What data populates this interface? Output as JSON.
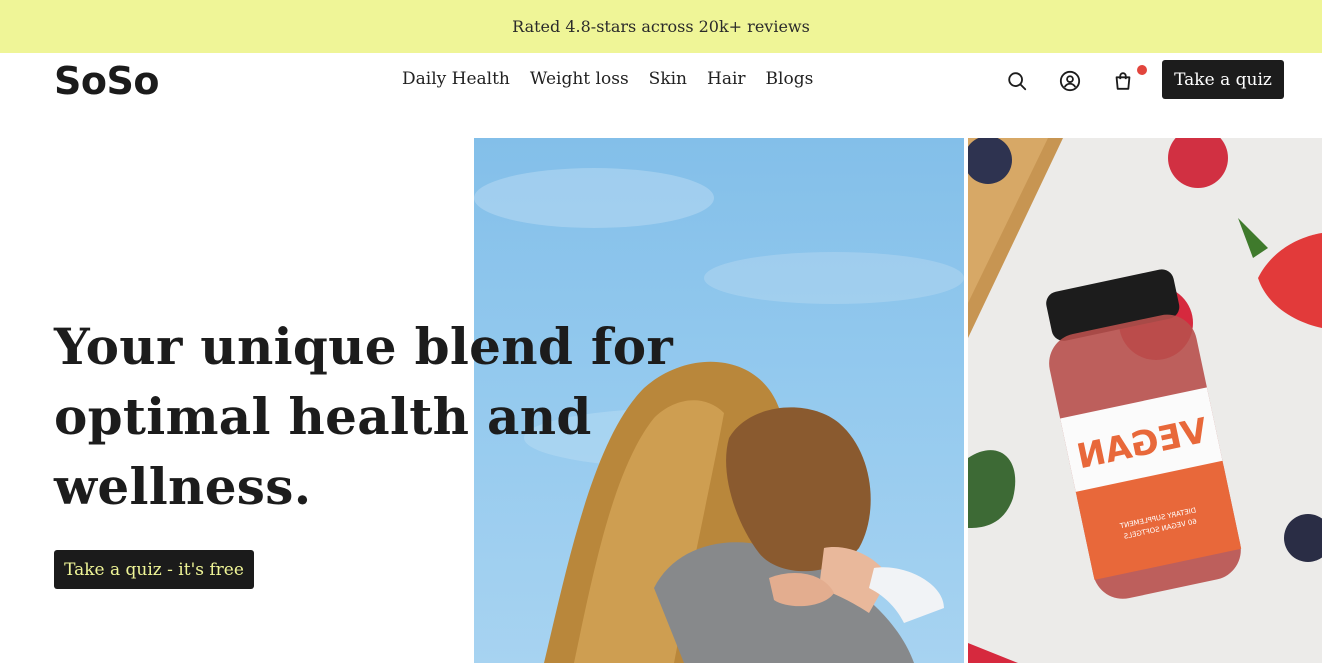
{
  "announcement": {
    "text": "Rated 4.8-stars across 20k+ reviews"
  },
  "header": {
    "logo": "SoSo",
    "nav": [
      "Daily Health",
      "Weight loss",
      "Skin",
      "Hair",
      "Blogs"
    ],
    "icons": {
      "search": "search-icon",
      "account": "user-circle-icon",
      "cart": "shopping-bag-icon"
    },
    "quiz_button": "Take a quiz"
  },
  "hero": {
    "headline": "Your unique blend for optimal health and wellness.",
    "cta": "Take a quiz - it's free"
  },
  "product": {
    "label": "VEGAN",
    "sub1": "DIETARY SUPPLEMENT",
    "sub2": "60 VEGAN SOFTGELS"
  },
  "colors": {
    "announcement_bg": "#eff597",
    "button_bg": "#1c1c1c",
    "cta_text": "#eff597",
    "cart_dot": "#e2453d",
    "label_orange": "#e8683a"
  }
}
